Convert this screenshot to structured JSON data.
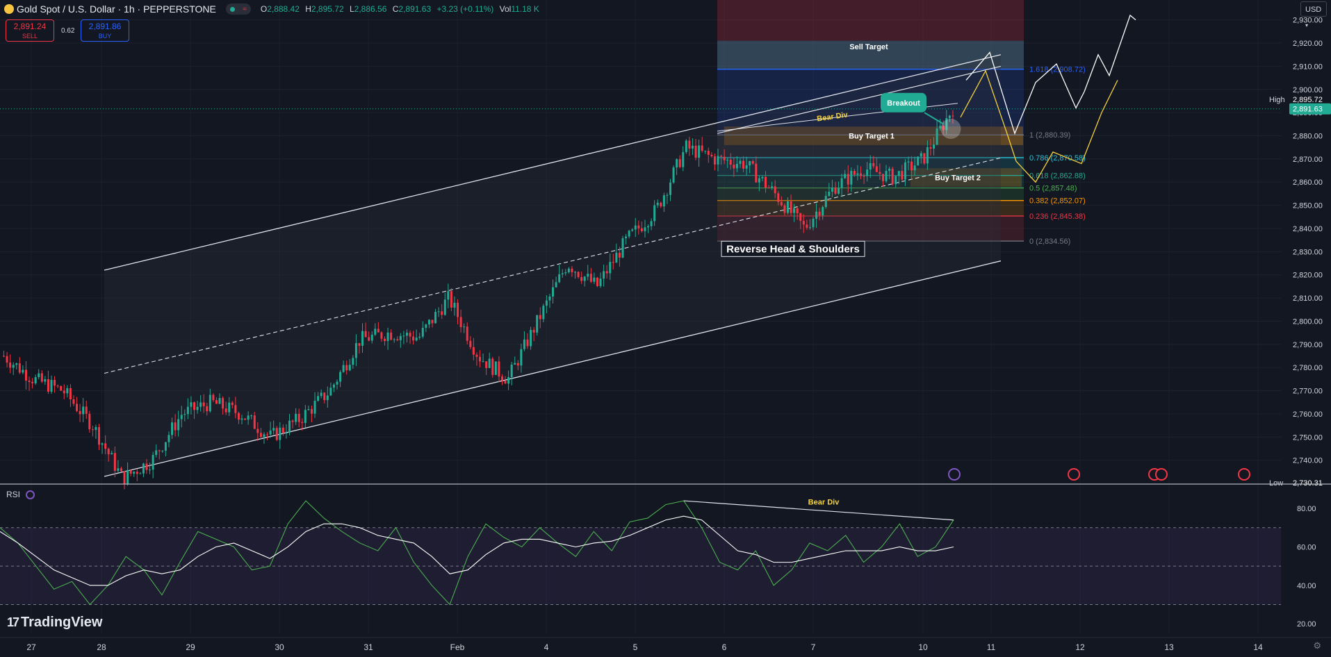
{
  "header": {
    "symbol": "Gold Spot / U.S. Dollar · 1h · PEPPERSTONE",
    "pill_icon": "≈",
    "open_label": "O",
    "open": "2,888.42",
    "high_label": "H",
    "high": "2,895.72",
    "low_label": "L",
    "low": "2,886.56",
    "close_label": "C",
    "close": "2,891.63",
    "change": "+3.23 (+0.11%)",
    "vol_label": "Vol",
    "vol": "11.18 K"
  },
  "trade": {
    "sell_price": "2,891.24",
    "sell_label": "SELL",
    "spread": "0.62",
    "buy_price": "2,891.86",
    "buy_label": "BUY"
  },
  "currency": "USD",
  "rsi_label": "RSI",
  "branding": "TradingView",
  "colors": {
    "bg": "#131722",
    "up": "#22ab94",
    "down": "#f23645",
    "rsi": "#4caf50",
    "accent": "#2962ff",
    "yellow": "#f5d23c"
  },
  "chart_data": [
    {
      "type": "candlestick",
      "title": "Gold Spot / U.S. Dollar · 1h · PEPPERSTONE",
      "x_ticks": [
        "27",
        "28",
        "29",
        "30",
        "31",
        "Feb",
        "4",
        "5",
        "6",
        "7",
        "10",
        "11",
        "12",
        "13",
        "14"
      ],
      "y_ticks": [
        2740,
        2750,
        2760,
        2770,
        2780,
        2790,
        2800,
        2810,
        2820,
        2830,
        2840,
        2850,
        2860,
        2870,
        2880,
        2890,
        2900,
        2910,
        2920,
        2930
      ],
      "ylim": [
        2730,
        2935
      ],
      "price_path": [
        [
          "27",
          2785
        ],
        [
          "27",
          2775
        ],
        [
          "27",
          2770
        ],
        [
          "28",
          2755
        ],
        [
          "28",
          2732
        ],
        [
          "28",
          2740
        ],
        [
          "29",
          2760
        ],
        [
          "29",
          2765
        ],
        [
          "29",
          2760
        ],
        [
          "30",
          2750
        ],
        [
          "30",
          2758
        ],
        [
          "30",
          2770
        ],
        [
          "31",
          2792
        ],
        [
          "31",
          2795
        ],
        [
          "31",
          2793
        ],
        [
          "Feb",
          2810
        ],
        [
          "Feb",
          2785
        ],
        [
          "Feb",
          2775
        ],
        [
          "4",
          2800
        ],
        [
          "4",
          2825
        ],
        [
          "4",
          2815
        ],
        [
          "5",
          2835
        ],
        [
          "5",
          2848
        ],
        [
          "5",
          2875
        ],
        [
          "6",
          2870
        ],
        [
          "6",
          2868
        ],
        [
          "6",
          2855
        ],
        [
          "7",
          2840
        ],
        [
          "7",
          2858
        ],
        [
          "7",
          2866
        ],
        [
          "10",
          2862
        ],
        [
          "10",
          2870
        ],
        [
          "10",
          2892
        ]
      ],
      "annotations": {
        "fib_levels": [
          {
            "label": "1.618 (2,908.72)",
            "value": 2908.72,
            "color": "#2962ff"
          },
          {
            "label": "1 (2,880.39)",
            "value": 2880.39,
            "color": "#787b86"
          },
          {
            "label": "0.786 (2,870.58)",
            "value": 2870.58,
            "color": "#26c6da"
          },
          {
            "label": "0.618 (2,862.88)",
            "value": 2862.88,
            "color": "#22ab94"
          },
          {
            "label": "0.5 (2,857.48)",
            "value": 2857.48,
            "color": "#4caf50"
          },
          {
            "label": "0.382 (2,852.07)",
            "value": 2852.07,
            "color": "#ff9800"
          },
          {
            "label": "0.236 (2,845.38)",
            "value": 2845.38,
            "color": "#f23645"
          },
          {
            "label": "0 (2,834.56)",
            "value": 2834.56,
            "color": "#787b86"
          }
        ],
        "texts": [
          "Sell Target",
          "Bear Div",
          "Breakout",
          "Buy Target 1",
          "Buy Target 2",
          "Reverse Head & Shoulders"
        ],
        "high_label": "High",
        "high_value": "2,895.72",
        "last_value": "2,891.63",
        "low_label": "Low",
        "low_value": "2,730.31"
      }
    },
    {
      "type": "line",
      "title": "RSI",
      "y_ticks": [
        20,
        40,
        60,
        80
      ],
      "ylim": [
        15,
        88
      ],
      "bands": [
        30,
        50,
        70
      ],
      "annotation": "Bear Div",
      "series": [
        {
          "values": [
            70,
            62,
            50,
            38,
            42,
            30,
            40,
            55,
            48,
            35,
            52,
            68,
            64,
            60,
            48,
            50,
            72,
            84,
            75,
            68,
            62,
            58,
            70,
            52,
            40,
            30,
            55,
            72,
            65,
            60,
            70,
            62,
            55,
            68,
            58,
            73,
            75,
            82,
            84,
            70,
            52,
            48,
            58,
            40,
            48,
            62,
            58,
            66,
            52,
            60,
            72,
            55,
            60,
            74
          ]
        },
        {
          "values": [
            68,
            62,
            55,
            48,
            44,
            40,
            40,
            45,
            48,
            46,
            48,
            55,
            60,
            62,
            58,
            54,
            60,
            68,
            72,
            72,
            70,
            66,
            64,
            62,
            55,
            46,
            48,
            56,
            62,
            64,
            64,
            62,
            60,
            62,
            63,
            66,
            70,
            74,
            76,
            74,
            66,
            58,
            56,
            52,
            52,
            54,
            56,
            58,
            58,
            58,
            60,
            58,
            58,
            60
          ]
        }
      ]
    }
  ]
}
